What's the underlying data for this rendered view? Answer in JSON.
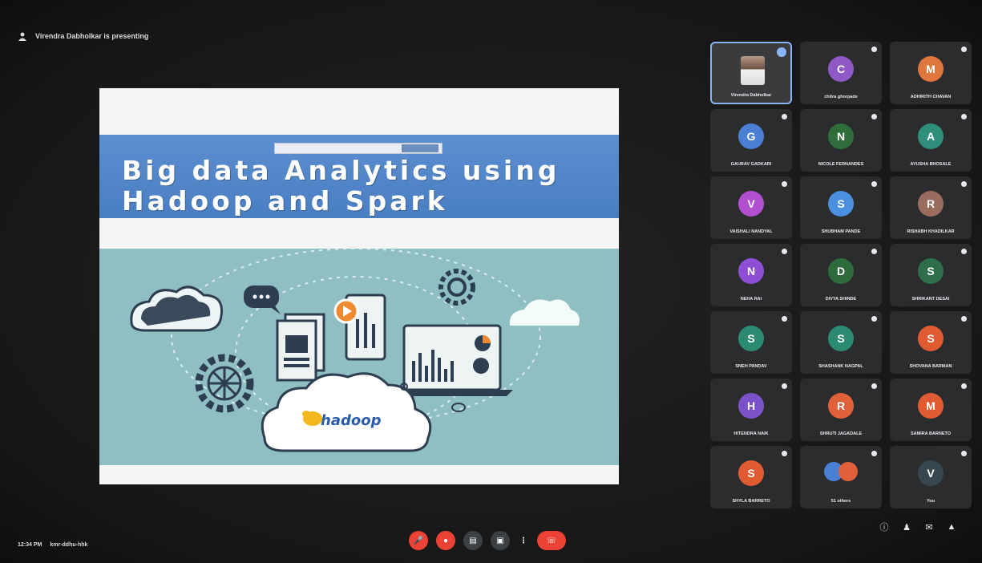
{
  "meeting": {
    "presenter_text": "Virendra Dabholkar is presenting",
    "time": "12:34 PM",
    "meeting_code": "kmr-ddhu-hhk"
  },
  "slide": {
    "title_line1": "Big data Analytics using",
    "title_line2": "Hadoop and Spark",
    "logo_text": "hadoop"
  },
  "participants": [
    {
      "name": "Virendra Dabholkar",
      "initial": "",
      "color": "",
      "has_photo": true,
      "active": true
    },
    {
      "name": "chitra ghorpade",
      "initial": "C",
      "color": "#8e59c6"
    },
    {
      "name": "ADHIRITH CHAVAN",
      "initial": "M",
      "color": "#e0763c"
    },
    {
      "name": "GAURAV GADKARI",
      "initial": "G",
      "color": "#4a7fd6"
    },
    {
      "name": "NICOLE FERNANDES",
      "initial": "N",
      "color": "#2f6e3b"
    },
    {
      "name": "AYUSHA BHOSALE",
      "initial": "A",
      "color": "#2f8f7a"
    },
    {
      "name": "VAISHALI NANDYAL",
      "initial": "V",
      "color": "#b24fcf"
    },
    {
      "name": "SHUBHAM PANDE",
      "initial": "S",
      "color": "#4a8fe0"
    },
    {
      "name": "RISHABH KHADILKAR",
      "initial": "R",
      "color": "#9a6c5e"
    },
    {
      "name": "NEHA RAI",
      "initial": "N",
      "color": "#8e4fd6"
    },
    {
      "name": "DIVYA SHINDE",
      "initial": "D",
      "color": "#2d6b3a"
    },
    {
      "name": "SHRIKANT DESAI",
      "initial": "S",
      "color": "#2f6e4b"
    },
    {
      "name": "SNEH PANDAV",
      "initial": "S",
      "color": "#2a8a72"
    },
    {
      "name": "SHASHANK NAGPAL",
      "initial": "S",
      "color": "#2a8a72"
    },
    {
      "name": "SHOVANA BARMAN",
      "initial": "S",
      "color": "#e05b32"
    },
    {
      "name": "HITENDRA NAIK",
      "initial": "H",
      "color": "#7b52c9"
    },
    {
      "name": "SHRUTI JAGADALE",
      "initial": "R",
      "color": "#e0603a"
    },
    {
      "name": "SAMIRA BARNETO",
      "initial": "M",
      "color": "#e05b32"
    },
    {
      "name": "SHYLA BARRETO",
      "initial": "S",
      "color": "#e05b32"
    },
    {
      "name": "51 others",
      "initial": "",
      "color": "",
      "duo": true
    },
    {
      "name": "You",
      "initial": "V",
      "color": "#37474f"
    }
  ],
  "controls": {
    "mic_label": "mic",
    "cam_label": "camera",
    "captions_label": "CC",
    "present_label": "present",
    "more_label": "more",
    "hangup_label": "end call"
  }
}
